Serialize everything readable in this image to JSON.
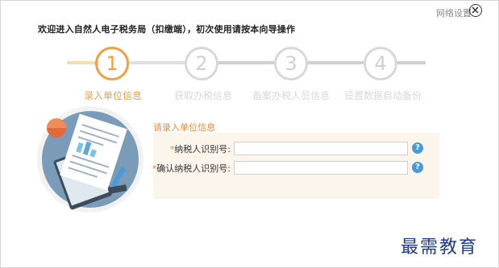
{
  "header": {
    "welcome_text": "欢迎进入自然人电子税务局（扣缴端），初次使用请按本向导操作",
    "network_settings_label": "网络设置"
  },
  "wizard": {
    "steps": [
      {
        "number": "1",
        "label": "录入单位信息",
        "state": "active"
      },
      {
        "number": "2",
        "label": "获取办税信息",
        "state": "inactive"
      },
      {
        "number": "3",
        "label": "备案办税人员信息",
        "state": "inactive"
      },
      {
        "number": "4",
        "label": "设置数据自动备份",
        "state": "inactive"
      }
    ]
  },
  "form": {
    "title": "请录入单位信息",
    "fields": [
      {
        "required_mark": "*",
        "label": "纳税人识别号:",
        "value": ""
      },
      {
        "required_mark": "*",
        "label": "确认纳税人识别号:",
        "value": ""
      }
    ],
    "help_symbol": "?"
  },
  "watermark": "最需教育",
  "colors": {
    "accent": "#f0a043",
    "inactive": "#d8d8d8",
    "help": "#4a9ad9",
    "panel": "#fcf5ec"
  }
}
